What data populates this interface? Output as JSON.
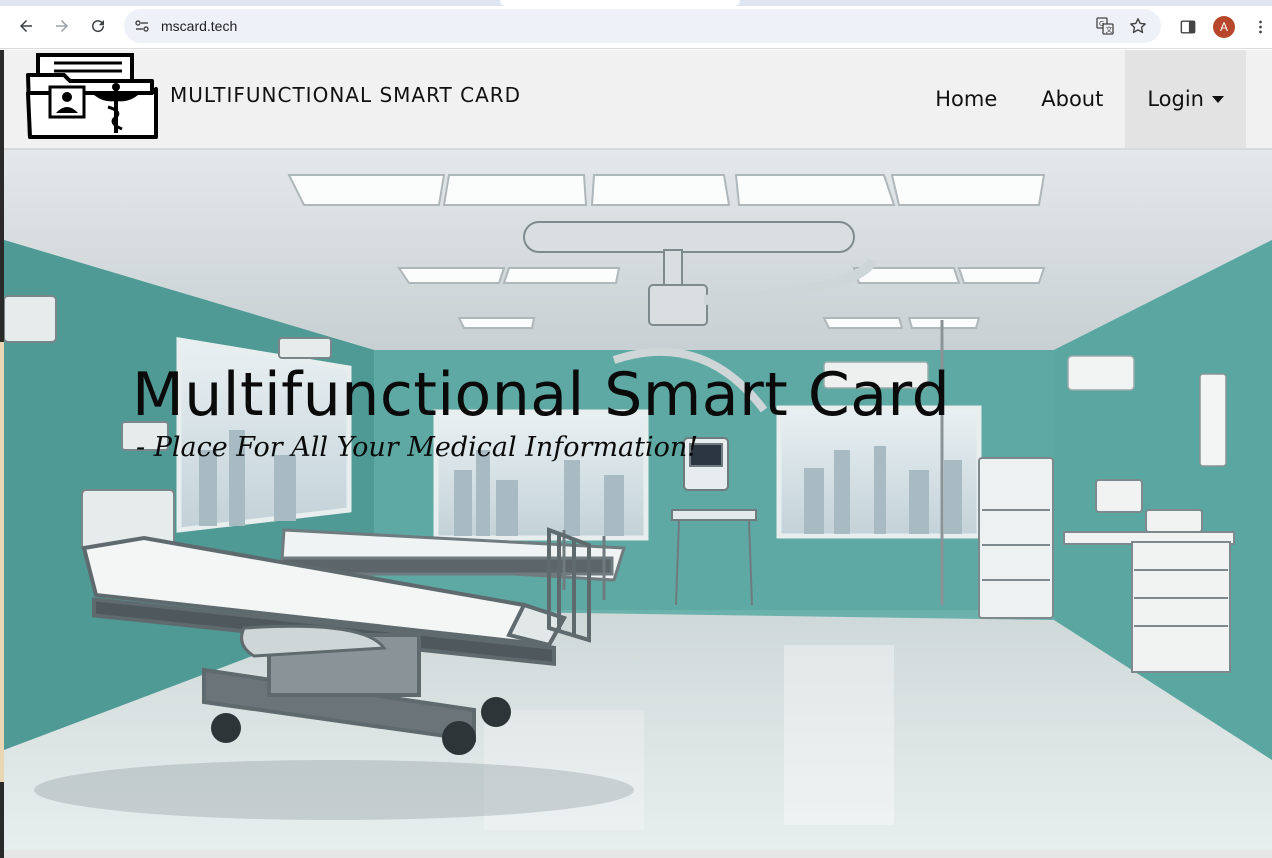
{
  "browser": {
    "url": "mscard.tech",
    "avatar_letter": "A",
    "icons": [
      "back-arrow-icon",
      "forward-arrow-icon",
      "reload-icon",
      "site-settings-icon",
      "translate-icon",
      "bookmark-star-icon",
      "side-panel-icon",
      "more-vert-icon"
    ]
  },
  "header": {
    "brand": "MULTIFUNCTIONAL SMART CARD",
    "nav": [
      {
        "label": "Home"
      },
      {
        "label": "About"
      },
      {
        "label": "Login"
      }
    ]
  },
  "hero": {
    "title": "Multifunctional Smart Card",
    "subtitle": "- Place For All Your Medical Information!"
  },
  "colors": {
    "header_bg": "#f1f1f1",
    "wall_teal": "#5ea9a3",
    "avatar": "#b6472a"
  }
}
